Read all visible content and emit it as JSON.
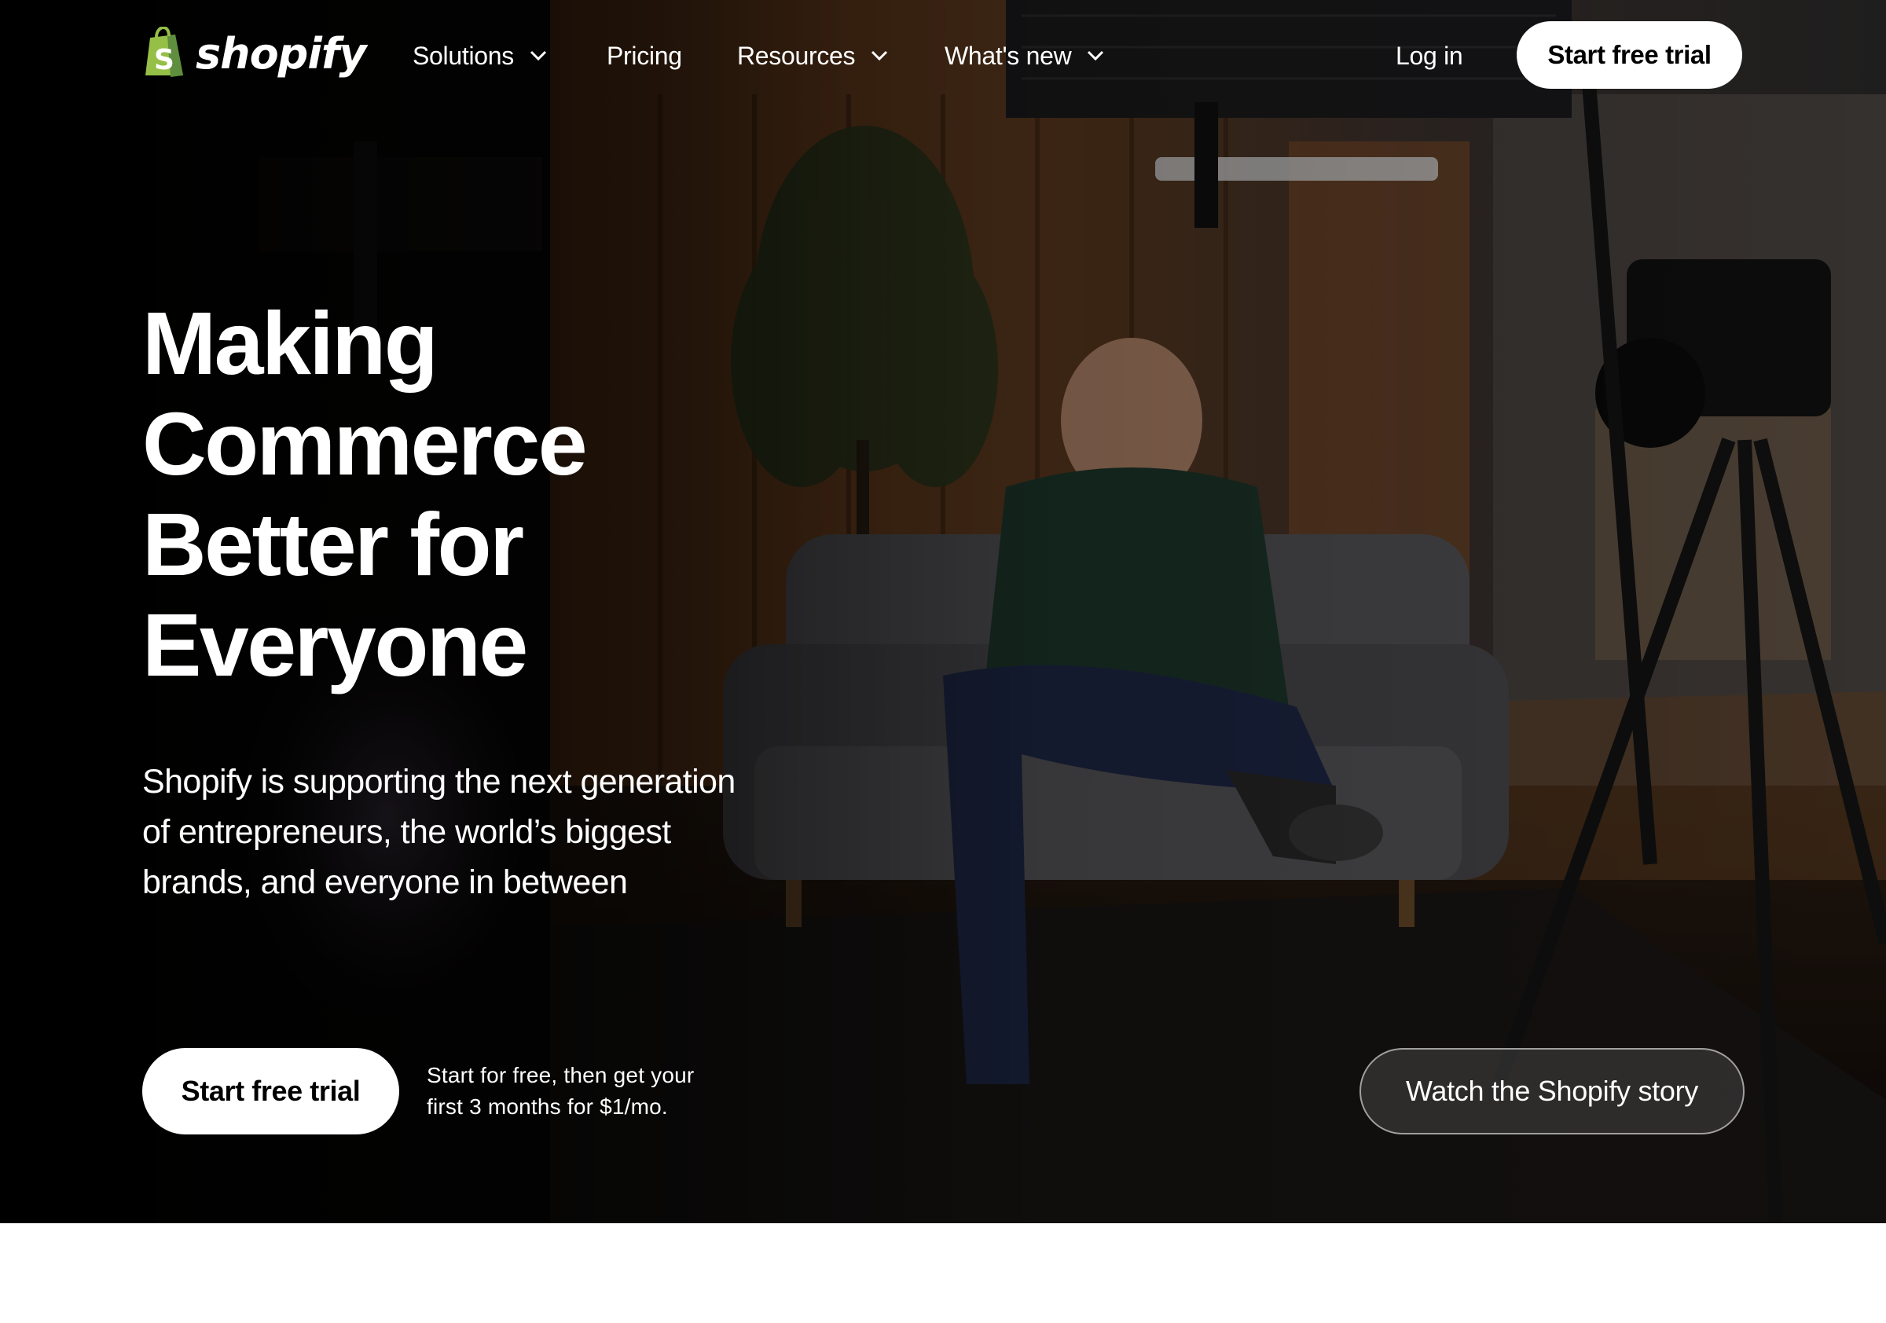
{
  "brand": {
    "name": "shopify",
    "accent_green": "#95bf47",
    "dark_green": "#5e8e3e"
  },
  "nav": {
    "items": [
      {
        "label": "Solutions",
        "has_dropdown": true
      },
      {
        "label": "Pricing",
        "has_dropdown": false
      },
      {
        "label": "Resources",
        "has_dropdown": true
      },
      {
        "label": "What's new",
        "has_dropdown": true
      }
    ],
    "login_label": "Log in",
    "cta_label": "Start free trial"
  },
  "hero": {
    "headline_lines": [
      "Making",
      "Commerce",
      "Better for",
      "Everyone"
    ],
    "subtext_lines": [
      "Shopify is supporting the next generation",
      "of entrepreneurs, the world’s biggest",
      "brands, and everyone in between"
    ],
    "cta_label": "Start free trial",
    "cta_note_lines": [
      "Start for free, then get your",
      "first 3 months for $1/mo."
    ],
    "watch_label": "Watch the Shopify story"
  }
}
